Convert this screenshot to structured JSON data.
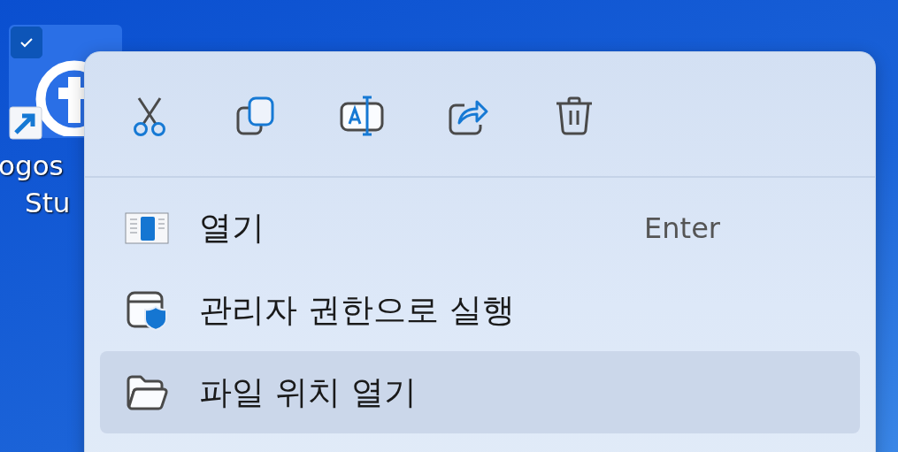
{
  "desktop_icon": {
    "label_lines": [
      "ogos",
      "Stu"
    ],
    "selected": true,
    "checked": true
  },
  "context_menu": {
    "items": [
      {
        "label": "열기",
        "shortcut": "Enter",
        "selected": false
      },
      {
        "label": "관리자 권한으로 실행",
        "selected": false
      },
      {
        "label": "파일 위치 열기",
        "selected": true
      }
    ]
  }
}
